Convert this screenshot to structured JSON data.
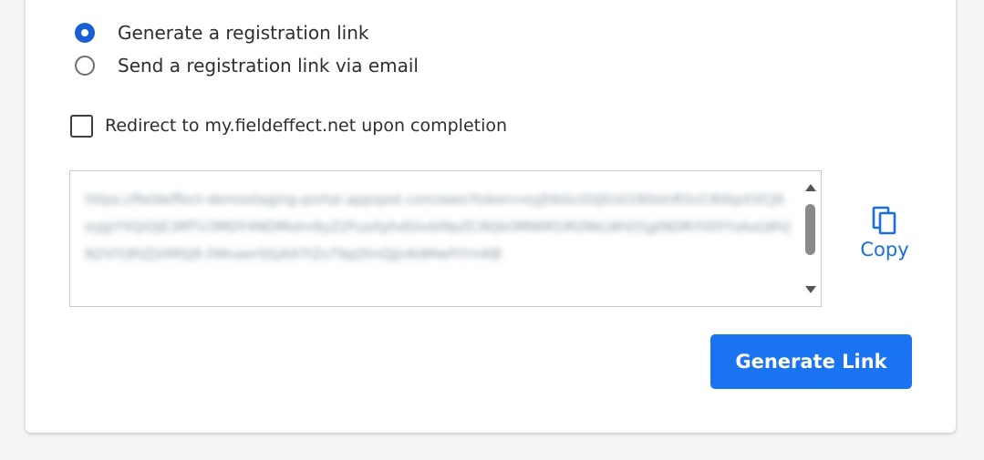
{
  "registration": {
    "options": [
      {
        "label": "Generate a registration link",
        "selected": true
      },
      {
        "label": "Send a registration link via email",
        "selected": false
      }
    ],
    "redirect": {
      "label": "Redirect to my.fieldeffect.net upon completion",
      "checked": false
    },
    "link_text": "https://fieldeffect-demostaging-portal.appspot.com/aws?token=eyJhbGciOiJIUzI1NiIsInR5cCI6IkpXVCJ9.eyJpYXQiOjE3MTU3MDY4NDMsIm9yZ2FuaXphdGlvbl9pZCI6IjkOMWM1M2NkLWVjYjgtNDRiYi05YzAxLWVjN2VlYjRlZjVlMSJ9.0WvaerSSjA97tZs79pj5tnQjjv6dMwFtYmKB",
    "copy_label": "Copy",
    "generate_label": "Generate Link"
  },
  "icons": {
    "copy": "copy-icon",
    "scroll_up": "scroll-up-icon",
    "scroll_down": "scroll-down-icon"
  },
  "colors": {
    "accent": "#1a5fd6",
    "button": "#1a73f0",
    "link": "#1a6fe0"
  }
}
